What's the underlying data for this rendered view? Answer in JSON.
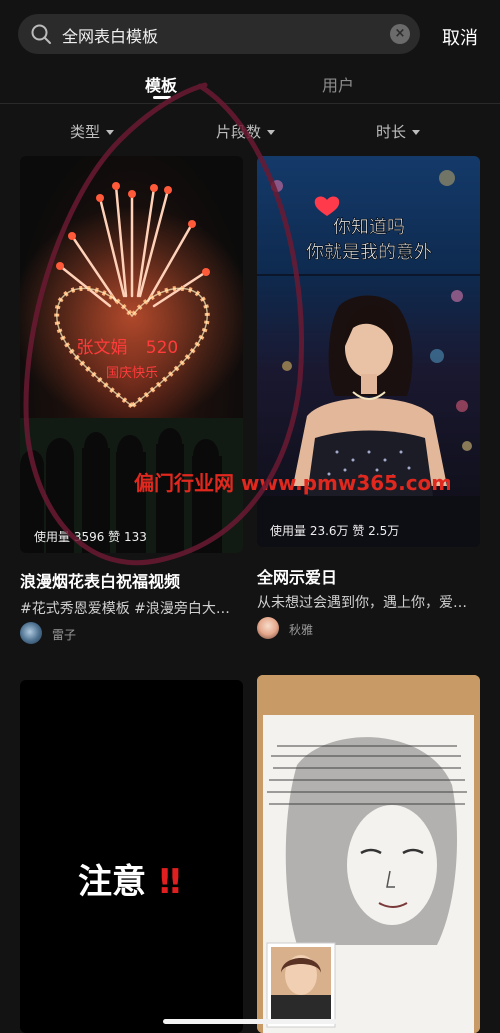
{
  "search": {
    "query": "全网表白模板",
    "cancel_label": "取消"
  },
  "tabs": [
    {
      "label": "模板"
    },
    {
      "label": "用户"
    }
  ],
  "filters": [
    {
      "label": "类型"
    },
    {
      "label": "片段数"
    },
    {
      "label": "时长"
    }
  ],
  "results": [
    {
      "stats": "使用量 3596 赞 133",
      "title": "浪漫烟花表白祝福视频",
      "description": "#花式秀恩爱模板 #浪漫旁白大…",
      "author": "雷子",
      "overlay_texts": [
        "张文娟",
        "520",
        "国庆快乐"
      ]
    },
    {
      "stats": "使用量 23.6万 赞 2.5万",
      "title": "全网示爱日",
      "description": "从未想过会遇到你，遇上你，爱…",
      "author": "秋雅",
      "caption_lines": [
        "你知道吗",
        "你就是我的意外"
      ]
    },
    {
      "overlay_text": "注意",
      "overlay_marks": "‼"
    },
    {}
  ],
  "watermark": "偏门行业网 www.pmw365.com",
  "colors": {
    "background": "#131313",
    "searchbar": "#2b2b2b",
    "active_tab": "#ffffff",
    "inactive_tab": "#8d8d8d",
    "watermark": "#e0281e"
  }
}
